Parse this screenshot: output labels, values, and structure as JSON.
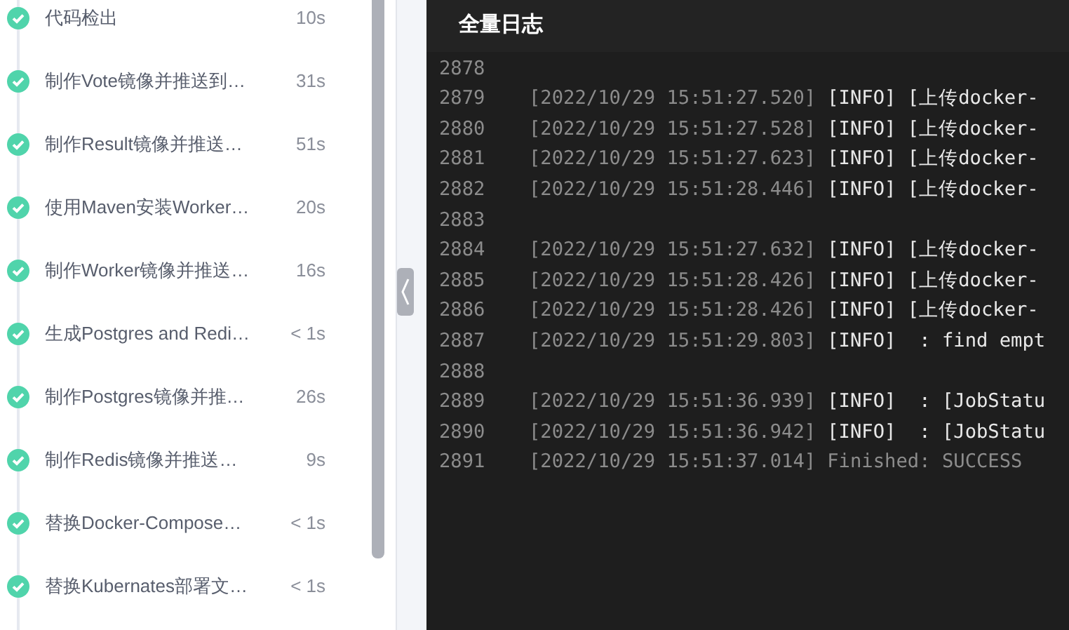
{
  "steps": [
    {
      "name": "代码检出",
      "duration": "10s",
      "succeeded": true
    },
    {
      "name": "制作Vote镜像并推送到…",
      "duration": "31s",
      "succeeded": true
    },
    {
      "name": "制作Result镜像并推送…",
      "duration": "51s",
      "succeeded": true
    },
    {
      "name": "使用Maven安装Worker…",
      "duration": "20s",
      "succeeded": true
    },
    {
      "name": "制作Worker镜像并推送…",
      "duration": "16s",
      "succeeded": true
    },
    {
      "name": "生成Postgres and Redi…",
      "duration": "< 1s",
      "succeeded": true
    },
    {
      "name": "制作Postgres镜像并推…",
      "duration": "26s",
      "succeeded": true
    },
    {
      "name": "制作Redis镜像并推送…",
      "duration": "9s",
      "succeeded": true
    },
    {
      "name": "替换Docker-Compose…",
      "duration": "< 1s",
      "succeeded": true
    },
    {
      "name": "替换Kubernates部署文…",
      "duration": "< 1s",
      "succeeded": true
    }
  ],
  "log": {
    "title": "全量日志",
    "lines": [
      {
        "number": "2878"
      },
      {
        "number": "2879",
        "time": "[2022/10/29 15:51:27.520]",
        "message": "[INFO] [上传docker-",
        "kind": "info"
      },
      {
        "number": "2880",
        "time": "[2022/10/29 15:51:27.528]",
        "message": "[INFO] [上传docker-",
        "kind": "info"
      },
      {
        "number": "2881",
        "time": "[2022/10/29 15:51:27.623]",
        "message": "[INFO] [上传docker-",
        "kind": "info"
      },
      {
        "number": "2882",
        "time": "[2022/10/29 15:51:28.446]",
        "message": "[INFO] [上传docker-",
        "kind": "info"
      },
      {
        "number": "2883"
      },
      {
        "number": "2884",
        "time": "[2022/10/29 15:51:27.632]",
        "message": "[INFO] [上传docker-",
        "kind": "info"
      },
      {
        "number": "2885",
        "time": "[2022/10/29 15:51:28.426]",
        "message": "[INFO] [上传docker-",
        "kind": "info"
      },
      {
        "number": "2886",
        "time": "[2022/10/29 15:51:28.426]",
        "message": "[INFO] [上传docker-",
        "kind": "info"
      },
      {
        "number": "2887",
        "time": "[2022/10/29 15:51:29.803]",
        "message": "[INFO]  : find empt",
        "kind": "info"
      },
      {
        "number": "2888"
      },
      {
        "number": "2889",
        "time": "[2022/10/29 15:51:36.939]",
        "message": "[INFO]  : [JobStatu",
        "kind": "info"
      },
      {
        "number": "2890",
        "time": "[2022/10/29 15:51:36.942]",
        "message": "[INFO]  : [JobStatu",
        "kind": "info"
      },
      {
        "number": "2891",
        "time": "[2022/10/29 15:51:37.014]",
        "message": "Finished: SUCCESS",
        "kind": "final"
      }
    ]
  }
}
